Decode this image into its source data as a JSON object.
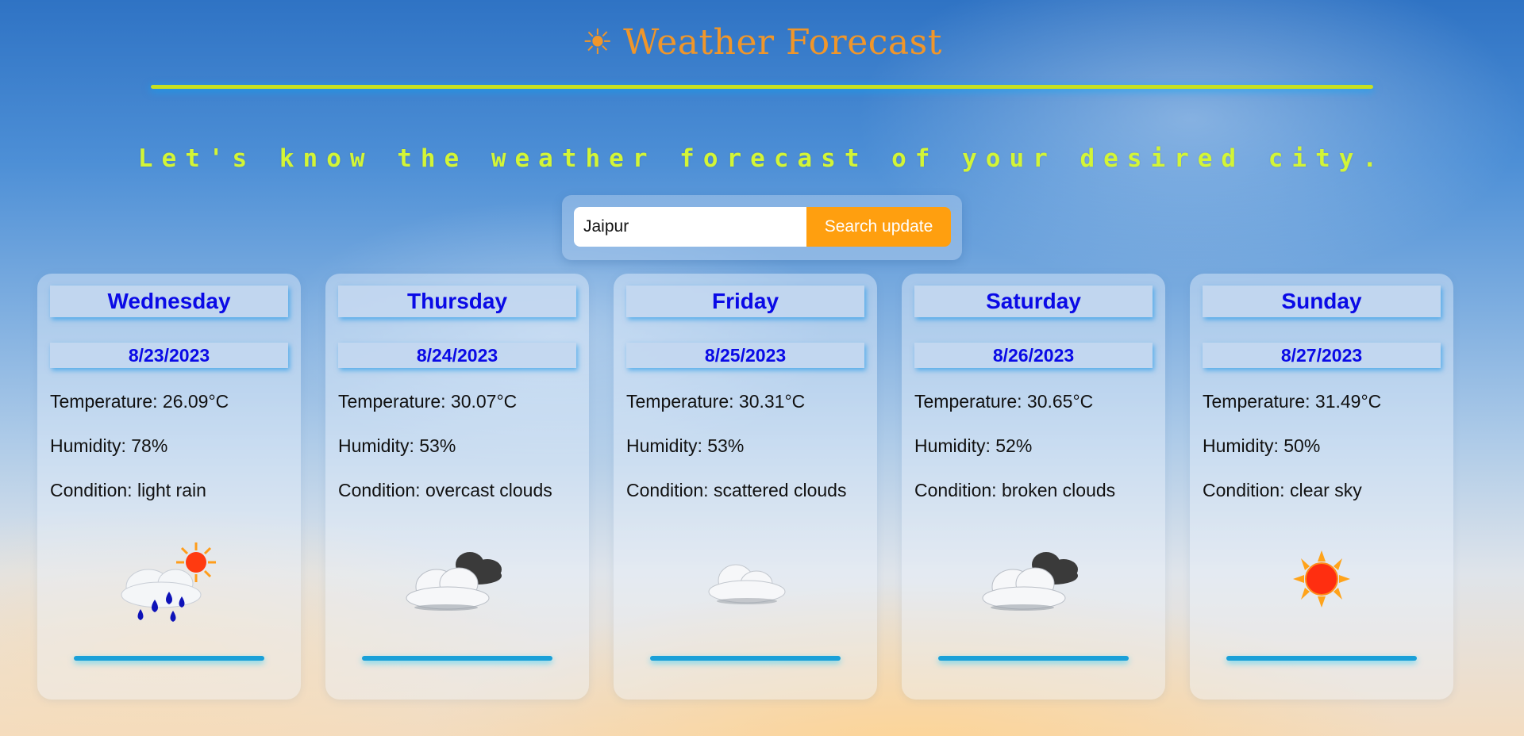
{
  "header": {
    "title_icon": "☀",
    "title": "Weather Forecast",
    "tagline": "Let's know the weather forecast of your desired city."
  },
  "search": {
    "value": "Jaipur",
    "placeholder": "",
    "button_label": "Search update"
  },
  "colors": {
    "title": "#f0962a",
    "tagline": "#d3f536",
    "day_text": "#0a0ae6",
    "button": "#ff9f0f",
    "card_bar": "#1aa0d8"
  },
  "forecast": [
    {
      "day": "Wednesday",
      "date": "8/23/2023",
      "temperature": "Temperature: 26.09°C",
      "humidity": "Humidity: 78%",
      "condition": "Condition: light rain",
      "icon": "light-rain-sun-icon"
    },
    {
      "day": "Thursday",
      "date": "8/24/2023",
      "temperature": "Temperature: 30.07°C",
      "humidity": "Humidity: 53%",
      "condition": "Condition: overcast clouds",
      "icon": "overcast-clouds-icon"
    },
    {
      "day": "Friday",
      "date": "8/25/2023",
      "temperature": "Temperature: 30.31°C",
      "humidity": "Humidity: 53%",
      "condition": "Condition: scattered clouds",
      "icon": "scattered-clouds-icon"
    },
    {
      "day": "Saturday",
      "date": "8/26/2023",
      "temperature": "Temperature: 30.65°C",
      "humidity": "Humidity: 52%",
      "condition": "Condition: broken clouds",
      "icon": "broken-clouds-icon"
    },
    {
      "day": "Sunday",
      "date": "8/27/2023",
      "temperature": "Temperature: 31.49°C",
      "humidity": "Humidity: 50%",
      "condition": "Condition: clear sky",
      "icon": "clear-sky-sun-icon"
    }
  ]
}
